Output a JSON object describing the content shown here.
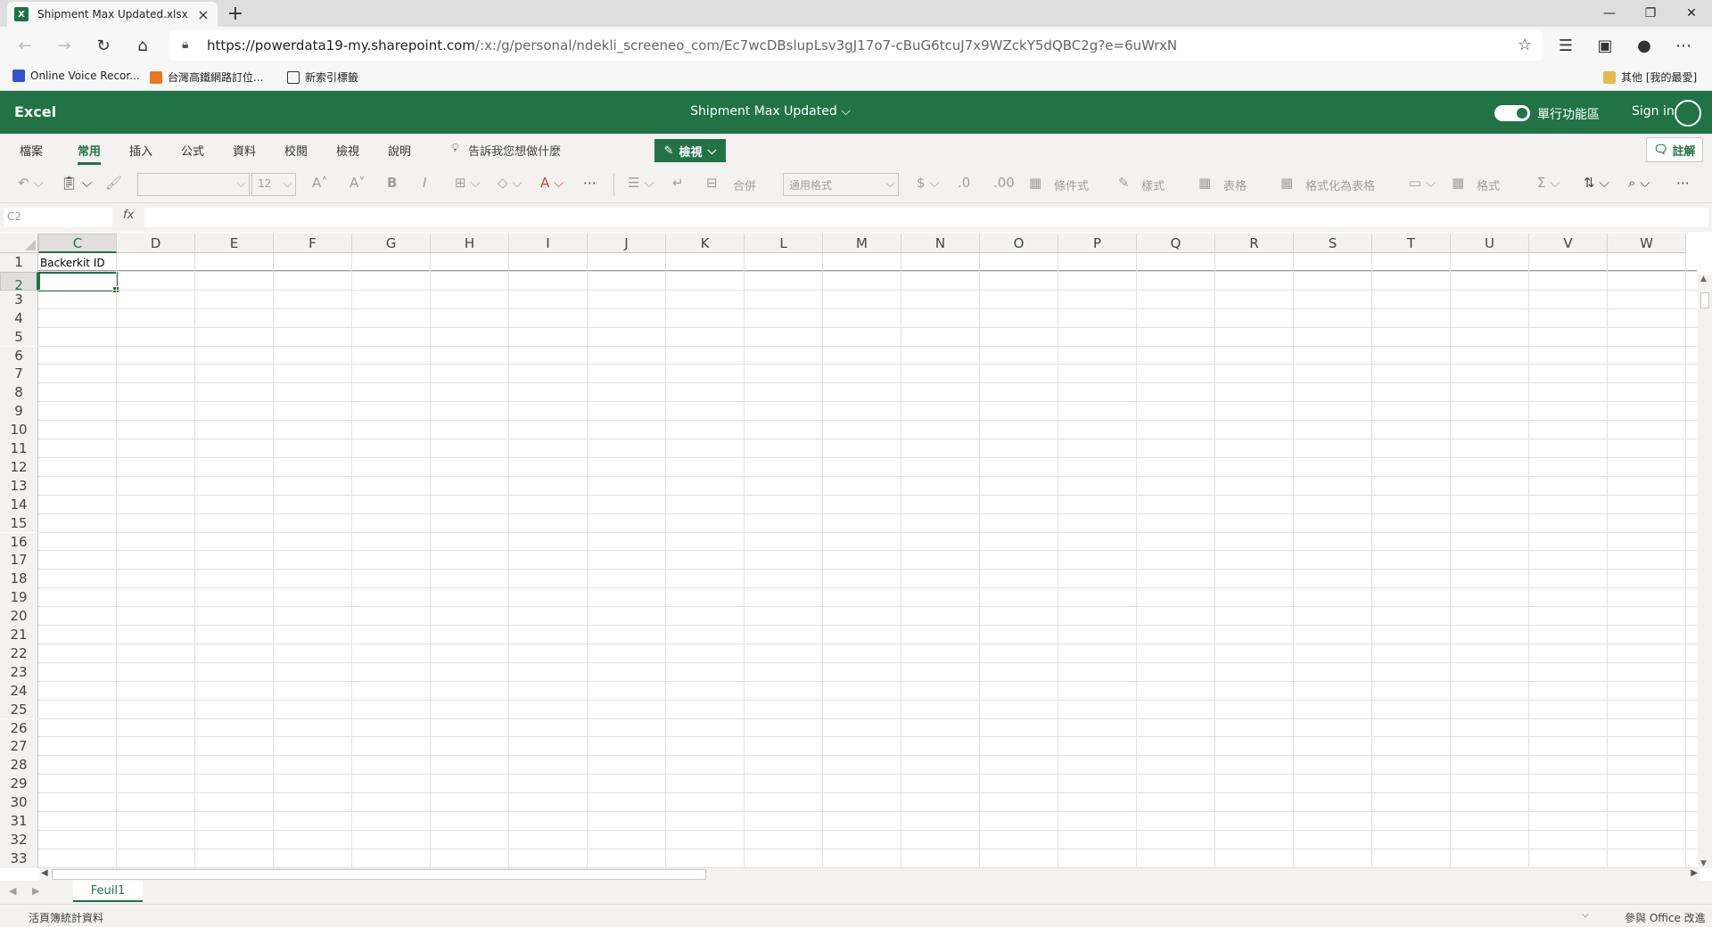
{
  "browser": {
    "tab_title": "Shipment Max Updated.xlsx",
    "url_host": "https://powerdata19-my.sharepoint.com",
    "url_path": "/:x:/g/personal/ndekli_screeneo_com/Ec7wcDBslupLsv3gJ17o7-cBuG6tcuJ7x9WZckY5dQBC2g?e=6uWrxN",
    "bookmarks": [
      "Online Voice Recor...",
      "台灣高鐵網路訂位...",
      "新索引標籤"
    ],
    "other_bookmarks": "其他 [我的最愛]"
  },
  "excel": {
    "app_name": "Excel",
    "doc_name": "Shipment Max Updated",
    "simplified_ribbon_label": "單行功能區",
    "sign_in": "Sign in"
  },
  "ribbon": {
    "tabs": [
      "檔案",
      "常用",
      "插入",
      "公式",
      "資料",
      "校閱",
      "檢視",
      "說明"
    ],
    "active_tab": "常用",
    "tell_me": "告訴我您想做什麼",
    "view_mode": "檢視",
    "comments": "註解",
    "font_size": "12",
    "number_format": "通用格式",
    "merge": "合併",
    "conditional_format": "條件式",
    "styles": "樣式",
    "table": "表格",
    "format_as_table": "格式化為表格",
    "format": "格式"
  },
  "formula_bar": {
    "name_box": "C2",
    "fx": "fx",
    "value": ""
  },
  "sheet": {
    "columns": [
      "C",
      "D",
      "E",
      "F",
      "G",
      "H",
      "I",
      "J",
      "K",
      "L",
      "M",
      "N",
      "O",
      "P",
      "Q",
      "R",
      "S",
      "T",
      "U",
      "V",
      "W"
    ],
    "selected_column": "C",
    "rows": [
      "1",
      "2",
      "3",
      "4",
      "5",
      "6",
      "7",
      "8",
      "9",
      "10",
      "11",
      "12",
      "13",
      "14",
      "15",
      "16",
      "17",
      "18",
      "19",
      "20",
      "21",
      "22",
      "23",
      "24",
      "25",
      "26",
      "27",
      "28",
      "29",
      "30",
      "31",
      "32",
      "33"
    ],
    "selected_row": "2",
    "cell_C1": "Backerkit ID",
    "active_cell": "C2",
    "tabs": [
      "Feuil1"
    ]
  },
  "status": {
    "left": "活頁簿統計資料",
    "right": "參與 Office 改進"
  },
  "colors": {
    "excel_green": "#217346",
    "ribbon_bg": "#f3f2f1"
  }
}
